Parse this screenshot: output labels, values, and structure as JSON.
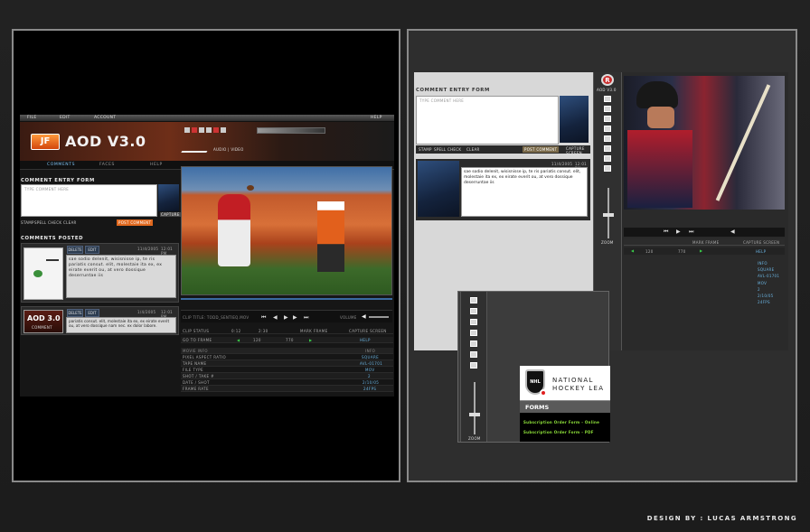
{
  "credit": "DESIGN BY : LUCAS ARMSTRONG",
  "left_app": {
    "menu": [
      "FILE",
      "EDIT",
      "ACCOUNT",
      "HELP"
    ],
    "logo_mark": "JF",
    "logo": "AOD V3.0",
    "sub_nav": "AUDIO | VIDEO",
    "tabs": [
      "COMMENTS",
      "FACES",
      "HELP"
    ],
    "comment_entry": {
      "title": "COMMENT ENTRY FORM",
      "placeholder": "TYPE COMMENT HERE",
      "actions": [
        "STAMP",
        "SPELL CHECK",
        "CLEAR"
      ],
      "post": "POST COMMENT",
      "capture": "CAPTURE SCREEN"
    },
    "comments_posted": {
      "title": "COMMENTS POSTED",
      "items": [
        {
          "buttons": [
            "DELETE",
            "EDIT"
          ],
          "date": "11/4/2005",
          "time": "12:01 PM",
          "text": "sae sodio delenit, wisisnisse ip, te ris pariatis consut. elit, molestaie ita ex, ex eirate everit ou, at vero dossique deserruntae iis"
        },
        {
          "buttons": [
            "DELETE",
            "EDIT"
          ],
          "date": "1/4/2005",
          "time": "12:01 PM",
          "badge": "AOD 3.0",
          "badge_sub": "COMMENT",
          "text": "pariatis consut. elit, molestaie ita ex, ex eirate everit ou, at vero dossique nam nec. ex dolor labore."
        }
      ]
    },
    "clip_title": "CLIP TITLE: TODD_SENTIEQ.MOV",
    "volume": "VOLUME",
    "clip_status": {
      "label": "CLIP STATUS",
      "in": "0:12",
      "out": "2:30",
      "mark": "MARK FRAME",
      "capture": "CAPTURE SCREEN"
    },
    "goto": {
      "label": "GO TO FRAME",
      "frame": "120",
      "frame2": "770",
      "help": "HELP"
    },
    "info_header": {
      "label": "MOVIE INFO",
      "right": "INFO"
    },
    "info_rows": [
      {
        "label": "PIXEL ASPECT RATIO",
        "value": "SQUARE"
      },
      {
        "label": "TAPE NAME",
        "value": "AVL-01701"
      },
      {
        "label": "FILE TYPE",
        "value": "MOV"
      },
      {
        "label": "SHOT / TAKE #",
        "value": "2"
      },
      {
        "label": "DATE / SHOT",
        "value": "2/10/05"
      },
      {
        "label": "FRAME RATE",
        "value": "24FPS"
      }
    ]
  },
  "right_app": {
    "comment_entry": {
      "title": "COMMENT ENTRY FORM",
      "placeholder": "TYPE COMMENT HERE",
      "actions": [
        "STAMP",
        "SPELL CHECK",
        "CLEAR"
      ],
      "post": "POST COMMENT",
      "capture": "CAPTURE SCREEN"
    },
    "comment": {
      "date": "11/4/2005",
      "time": "12:01 PM",
      "text": "sae sodio delenit, wisisnisse ip, te ris pariatis consut. elit, molestaie ita ex, ex eirate everit ou, at vero dossique deserruntae iis"
    },
    "side_logo": "R",
    "side_title": "AOD V3.0",
    "zoom": "ZOOM",
    "mark": "MARK FRAME",
    "capture": "CAPTURE SCREEN",
    "frame": "120",
    "frame2": "770",
    "help": "HELP",
    "info_values": [
      "INFO",
      "SQUARE",
      "AVL-01701",
      "MOV",
      "2",
      "2/10/05",
      "24FPS"
    ]
  },
  "nhl": {
    "shield": "NHL",
    "name": "NATIONAL HOCKEY LEA",
    "forms_title": "FORMS",
    "links": [
      "Subscription Order Form - Online",
      "Subscription Order Form - PDF"
    ],
    "zoom": "ZOOM"
  },
  "colors": {
    "accent_orange": "#e0681e",
    "link_green": "#8fe23a",
    "info_blue": "#6ab3e0"
  }
}
